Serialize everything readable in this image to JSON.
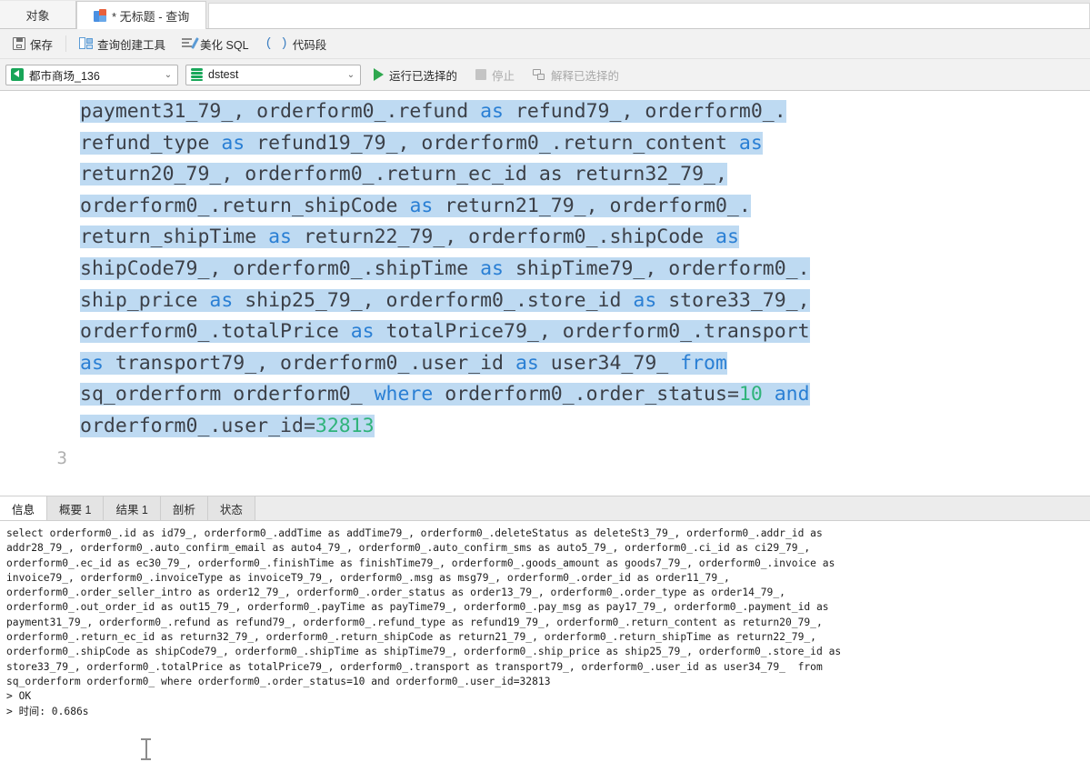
{
  "window": {
    "tabs": [
      {
        "label": "对象",
        "icon": "",
        "active": false
      },
      {
        "label": "* 无标题 - 查询",
        "icon": "query-icon",
        "active": true
      }
    ]
  },
  "toolbar": {
    "save_label": "保存",
    "query_builder_label": "查询创建工具",
    "beautify_sql_label": "美化 SQL",
    "code_snippet_label": "代码段",
    "code_snippet_icon": "( )"
  },
  "connection_bar": {
    "connection_value": "都市商场_136",
    "database_value": "dstest",
    "chevron": "⌄",
    "run_selected_label": "运行已选择的",
    "stop_label": "停止",
    "explain_selected_label": "解释已选择的"
  },
  "editor": {
    "line_numbers": [
      "3"
    ],
    "visible_lines": [
      [
        {
          "t": "payment31_79_, orderform0_.refund ",
          "c": "sel"
        },
        {
          "t": "as",
          "c": "sel kw"
        },
        {
          "t": " refund79_, orderform0_.",
          "c": "sel"
        }
      ],
      [
        {
          "t": "refund_type ",
          "c": "sel"
        },
        {
          "t": "as",
          "c": "sel kw"
        },
        {
          "t": " refund19_79_, orderform0_.return_content ",
          "c": "sel"
        },
        {
          "t": "as",
          "c": "sel kw"
        }
      ],
      [
        {
          "t": "return20_79_, orderform0_.return_ec_id as return32_79_,",
          "c": "sel"
        }
      ],
      [
        {
          "t": "orderform0_.return_shipCode ",
          "c": "sel"
        },
        {
          "t": "as",
          "c": "sel kw"
        },
        {
          "t": " return21_79_, orderform0_.",
          "c": "sel"
        }
      ],
      [
        {
          "t": "return_shipTime ",
          "c": "sel"
        },
        {
          "t": "as",
          "c": "sel kw"
        },
        {
          "t": " return22_79_, orderform0_.shipCode ",
          "c": "sel"
        },
        {
          "t": "as",
          "c": "sel kw"
        }
      ],
      [
        {
          "t": "shipCode79_, orderform0_.shipTime ",
          "c": "sel"
        },
        {
          "t": "as",
          "c": "sel kw"
        },
        {
          "t": " shipTime79_, orderform0_.",
          "c": "sel"
        }
      ],
      [
        {
          "t": "ship_price ",
          "c": "sel"
        },
        {
          "t": "as",
          "c": "sel kw"
        },
        {
          "t": " ship25_79_, orderform0_.store_id ",
          "c": "sel"
        },
        {
          "t": "as",
          "c": "sel kw"
        },
        {
          "t": " store33_79_,",
          "c": "sel"
        }
      ],
      [
        {
          "t": "orderform0_.totalPrice ",
          "c": "sel"
        },
        {
          "t": "as",
          "c": "sel kw"
        },
        {
          "t": " totalPrice79_, orderform0_.transport",
          "c": "sel"
        }
      ],
      [
        {
          "t": "as",
          "c": "sel kw"
        },
        {
          "t": " transport79_, orderform0_.user_id ",
          "c": "sel"
        },
        {
          "t": "as",
          "c": "sel kw"
        },
        {
          "t": " user34_79_ ",
          "c": "sel"
        },
        {
          "t": "from",
          "c": "sel kw"
        }
      ],
      [
        {
          "t": "sq_orderform orderform0_ ",
          "c": "sel"
        },
        {
          "t": "where",
          "c": "sel kw"
        },
        {
          "t": " orderform0_.order_status=",
          "c": "sel"
        },
        {
          "t": "10",
          "c": "sel num"
        },
        {
          "t": " ",
          "c": "sel"
        },
        {
          "t": "and",
          "c": "sel kw"
        }
      ],
      [
        {
          "t": "orderform0_.user_id=",
          "c": "sel"
        },
        {
          "t": "32813",
          "c": "sel num"
        }
      ]
    ]
  },
  "result_panel": {
    "tabs": [
      {
        "label": "信息",
        "active": true
      },
      {
        "label": "概要 1",
        "active": false
      },
      {
        "label": "结果 1",
        "active": false
      },
      {
        "label": "剖析",
        "active": false
      },
      {
        "label": "状态",
        "active": false
      }
    ],
    "log_lines": [
      "select orderform0_.id as id79_, orderform0_.addTime as addTime79_, orderform0_.deleteStatus as deleteSt3_79_, orderform0_.addr_id as",
      "addr28_79_, orderform0_.auto_confirm_email as auto4_79_, orderform0_.auto_confirm_sms as auto5_79_, orderform0_.ci_id as ci29_79_,",
      "orderform0_.ec_id as ec30_79_, orderform0_.finishTime as finishTime79_, orderform0_.goods_amount as goods7_79_, orderform0_.invoice as",
      "invoice79_, orderform0_.invoiceType as invoiceT9_79_, orderform0_.msg as msg79_, orderform0_.order_id as order11_79_,",
      "orderform0_.order_seller_intro as order12_79_, orderform0_.order_status as order13_79_, orderform0_.order_type as order14_79_,",
      "orderform0_.out_order_id as out15_79_, orderform0_.payTime as payTime79_, orderform0_.pay_msg as pay17_79_, orderform0_.payment_id as",
      "payment31_79_, orderform0_.refund as refund79_, orderform0_.refund_type as refund19_79_, orderform0_.return_content as return20_79_,",
      "orderform0_.return_ec_id as return32_79_, orderform0_.return_shipCode as return21_79_, orderform0_.return_shipTime as return22_79_,",
      "orderform0_.shipCode as shipCode79_, orderform0_.shipTime as shipTime79_, orderform0_.ship_price as ship25_79_, orderform0_.store_id as",
      "store33_79_, orderform0_.totalPrice as totalPrice79_, orderform0_.transport as transport79_, orderform0_.user_id as user34_79_  from",
      "sq_orderform orderform0_ where orderform0_.order_status=10 and orderform0_.user_id=32813",
      "> OK",
      "> 时间: 0.686s"
    ]
  },
  "colors": {
    "selection": "#bedaf2",
    "keyword": "#2a7fd4",
    "number": "#2fb37a",
    "code_text": "#3c4048",
    "run_green": "#2fa84f"
  }
}
